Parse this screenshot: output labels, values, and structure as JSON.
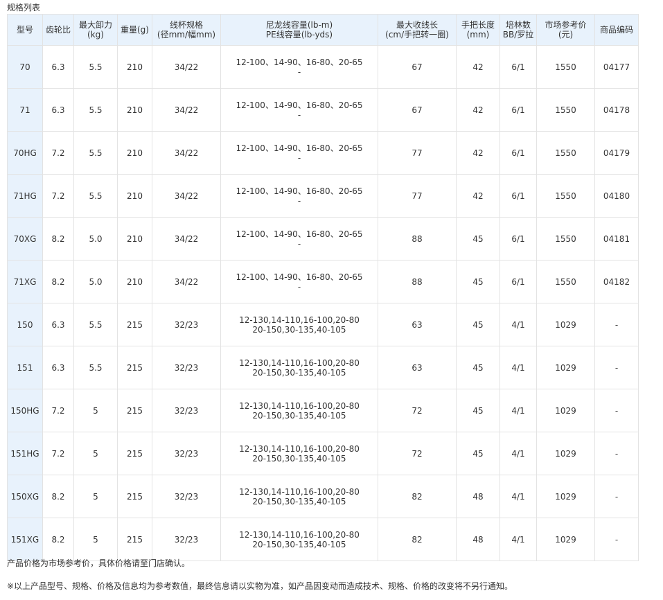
{
  "section_title": "规格列表",
  "headers": [
    {
      "line1": "型号",
      "line2": ""
    },
    {
      "line1": "齿轮比",
      "line2": ""
    },
    {
      "line1": "最大卸力",
      "line2": "(kg)"
    },
    {
      "line1": "重量(g)",
      "line2": ""
    },
    {
      "line1": "线杯规格",
      "line2": "(径mm/幅mm)"
    },
    {
      "line1": "尼龙线容量(lb-m)",
      "line2": "PE线容量(lb-yds)"
    },
    {
      "line1": "最大收线长",
      "line2": "(cm/手把转一圈)"
    },
    {
      "line1": "手把长度",
      "line2": "(mm)"
    },
    {
      "line1": "培林数",
      "line2": "BB/罗拉"
    },
    {
      "line1": "市场参考价",
      "line2": "(元)"
    },
    {
      "line1": "商品编码",
      "line2": ""
    }
  ],
  "rows": [
    {
      "model": "70",
      "gear": "6.3",
      "drag": "5.5",
      "weight": "210",
      "spool": "34/22",
      "cap1": "12-100、14-90、16-80、20-65",
      "cap2": "-",
      "retrieve": "67",
      "handle": "42",
      "bearings": "6/1",
      "price": "1550",
      "code": "04177"
    },
    {
      "model": "71",
      "gear": "6.3",
      "drag": "5.5",
      "weight": "210",
      "spool": "34/22",
      "cap1": "12-100、14-90、16-80、20-65",
      "cap2": "-",
      "retrieve": "67",
      "handle": "42",
      "bearings": "6/1",
      "price": "1550",
      "code": "04178"
    },
    {
      "model": "70HG",
      "gear": "7.2",
      "drag": "5.5",
      "weight": "210",
      "spool": "34/22",
      "cap1": "12-100、14-90、16-80、20-65",
      "cap2": "-",
      "retrieve": "77",
      "handle": "42",
      "bearings": "6/1",
      "price": "1550",
      "code": "04179"
    },
    {
      "model": "71HG",
      "gear": "7.2",
      "drag": "5.5",
      "weight": "210",
      "spool": "34/22",
      "cap1": "12-100、14-90、16-80、20-65",
      "cap2": "-",
      "retrieve": "77",
      "handle": "42",
      "bearings": "6/1",
      "price": "1550",
      "code": "04180"
    },
    {
      "model": "70XG",
      "gear": "8.2",
      "drag": "5.0",
      "weight": "210",
      "spool": "34/22",
      "cap1": "12-100、14-90、16-80、20-65",
      "cap2": "-",
      "retrieve": "88",
      "handle": "45",
      "bearings": "6/1",
      "price": "1550",
      "code": "04181"
    },
    {
      "model": "71XG",
      "gear": "8.2",
      "drag": "5.0",
      "weight": "210",
      "spool": "34/22",
      "cap1": "12-100、14-90、16-80、20-65",
      "cap2": "-",
      "retrieve": "88",
      "handle": "45",
      "bearings": "6/1",
      "price": "1550",
      "code": "04182"
    },
    {
      "model": "150",
      "gear": "6.3",
      "drag": "5.5",
      "weight": "215",
      "spool": "32/23",
      "cap1": "12-130,14-110,16-100,20-80",
      "cap2": "20-150,30-135,40-105",
      "retrieve": "63",
      "handle": "45",
      "bearings": "4/1",
      "price": "1029",
      "code": "-"
    },
    {
      "model": "151",
      "gear": "6.3",
      "drag": "5.5",
      "weight": "215",
      "spool": "32/23",
      "cap1": "12-130,14-110,16-100,20-80",
      "cap2": "20-150,30-135,40-105",
      "retrieve": "63",
      "handle": "45",
      "bearings": "4/1",
      "price": "1029",
      "code": "-"
    },
    {
      "model": "150HG",
      "gear": "7.2",
      "drag": "5",
      "weight": "215",
      "spool": "32/23",
      "cap1": "12-130,14-110,16-100,20-80",
      "cap2": "20-150,30-135,40-105",
      "retrieve": "72",
      "handle": "45",
      "bearings": "4/1",
      "price": "1029",
      "code": "-"
    },
    {
      "model": "151HG",
      "gear": "7.2",
      "drag": "5",
      "weight": "215",
      "spool": "32/23",
      "cap1": "12-130,14-110,16-100,20-80",
      "cap2": "20-150,30-135,40-105",
      "retrieve": "72",
      "handle": "45",
      "bearings": "4/1",
      "price": "1029",
      "code": "-"
    },
    {
      "model": "150XG",
      "gear": "8.2",
      "drag": "5",
      "weight": "215",
      "spool": "32/23",
      "cap1": "12-130,14-110,16-100,20-80",
      "cap2": "20-150,30-135,40-105",
      "retrieve": "82",
      "handle": "48",
      "bearings": "4/1",
      "price": "1029",
      "code": "-"
    },
    {
      "model": "151XG",
      "gear": "8.2",
      "drag": "5",
      "weight": "215",
      "spool": "32/23",
      "cap1": "12-130,14-110,16-100,20-80",
      "cap2": "20-150,30-135,40-105",
      "retrieve": "82",
      "handle": "48",
      "bearings": "4/1",
      "price": "1029",
      "code": "-"
    }
  ],
  "notes": {
    "price_note": "产品价格为市场参考价，具体价格请至门店确认。",
    "disclaimer": "※以上产品型号、规格、价格及信息均为参考数值，最终信息请以实物为准，如产品因变动而造成技术、规格、价格的改变将不另行通知。"
  },
  "colors": {
    "header_bg": "#e8f2fc",
    "border": "#e3e3e3",
    "text": "#333333"
  }
}
